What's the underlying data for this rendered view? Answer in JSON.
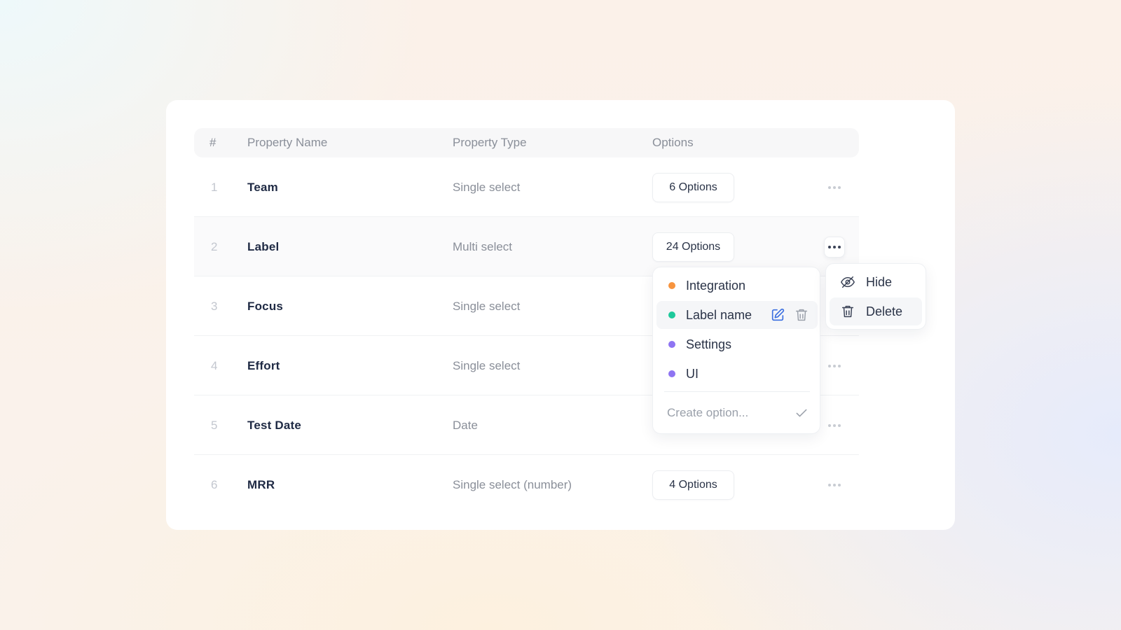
{
  "table": {
    "headers": {
      "num": "#",
      "name": "Property Name",
      "type": "Property Type",
      "options": "Options"
    },
    "rows": [
      {
        "num": "1",
        "name": "Team",
        "type": "Single select",
        "options": "6 Options"
      },
      {
        "num": "2",
        "name": "Label",
        "type": "Multi select",
        "options": "24 Options"
      },
      {
        "num": "3",
        "name": "Focus",
        "type": "Single select",
        "options": ""
      },
      {
        "num": "4",
        "name": "Effort",
        "type": "Single select",
        "options": ""
      },
      {
        "num": "5",
        "name": "Test Date",
        "type": "Date",
        "options": ""
      },
      {
        "num": "6",
        "name": "MRR",
        "type": "Single select (number)",
        "options": "4 Options"
      }
    ]
  },
  "options_dropdown": {
    "items": [
      {
        "label": "Integration",
        "color": "#f7943e"
      },
      {
        "label": "Label name",
        "color": "#1ec99b"
      },
      {
        "label": "Settings",
        "color": "#8e74f2"
      },
      {
        "label": "UI",
        "color": "#8e74f2"
      }
    ],
    "create_placeholder": "Create option..."
  },
  "context_menu": {
    "items": [
      {
        "label": "Hide",
        "icon": "eye-off-icon"
      },
      {
        "label": "Delete",
        "icon": "trash-icon"
      }
    ]
  },
  "colors": {
    "accent": "#3b6fe0",
    "text": "#1f2a44",
    "muted": "#8a8f99"
  }
}
